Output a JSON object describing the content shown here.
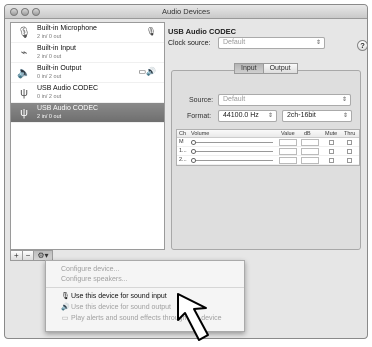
{
  "window": {
    "title": "Audio Devices"
  },
  "devices": [
    {
      "name": "Built-in Microphone",
      "io": "2 in/ 0 out",
      "icon": "microphone-icon",
      "badge": "🎙",
      "selected": false
    },
    {
      "name": "Built-in Input",
      "io": "2 in/ 0 out",
      "icon": "line-input-icon",
      "badge": "",
      "selected": false
    },
    {
      "name": "Built-in Output",
      "io": "0 in/ 2 out",
      "icon": "speaker-icon",
      "badge": "▭🔊",
      "selected": false
    },
    {
      "name": "USB Audio CODEC",
      "io": "0 in/ 2 out",
      "icon": "usb-icon",
      "badge": "",
      "selected": false
    },
    {
      "name": "USB Audio CODEC",
      "io": "2 in/ 0 out",
      "icon": "usb-icon",
      "badge": "",
      "selected": true
    }
  ],
  "pane_buttons": {
    "add": "+",
    "remove": "−",
    "gear": "⚙▾"
  },
  "detail": {
    "device_title": "USB Audio CODEC",
    "clock_label": "Clock source:",
    "clock_value": "Default",
    "help": "?",
    "tabs": [
      "Input",
      "Output"
    ],
    "active_tab": "Input",
    "source_label": "Source:",
    "source_value": "Default",
    "format_label": "Format:",
    "format_rate": "44100.0 Hz",
    "format_bits": "2ch-16bit"
  },
  "channel_table": {
    "headers": [
      "Ch",
      "Volume",
      "Value",
      "dB",
      "Mute",
      "Thru"
    ],
    "rows": [
      "M",
      "1...",
      "2..."
    ]
  },
  "menu": {
    "items": [
      {
        "label": "Configure device...",
        "disabled": true
      },
      {
        "label": "Configure speakers...",
        "disabled": true
      },
      {
        "label": "Use this device for sound input",
        "disabled": false,
        "icon": "microphone-icon"
      },
      {
        "label": "Use this device for sound output",
        "disabled": true,
        "icon": "speaker-icon"
      },
      {
        "label": "Play alerts and sound effects through this device",
        "disabled": true,
        "icon": "alert-icon"
      }
    ]
  }
}
